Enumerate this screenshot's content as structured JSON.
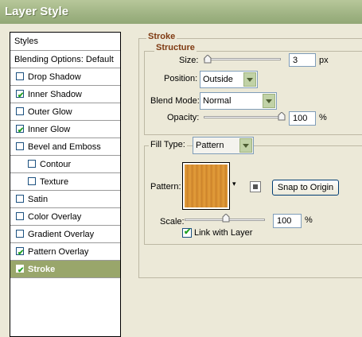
{
  "window": {
    "title": "Layer Style"
  },
  "sidebar": {
    "header": "Styles",
    "blending": "Blending Options: Default",
    "items": [
      {
        "label": "Drop Shadow",
        "checked": false
      },
      {
        "label": "Inner Shadow",
        "checked": true
      },
      {
        "label": "Outer Glow",
        "checked": false
      },
      {
        "label": "Inner Glow",
        "checked": true
      },
      {
        "label": "Bevel and Emboss",
        "checked": false
      },
      {
        "label": "Contour",
        "checked": false
      },
      {
        "label": "Texture",
        "checked": false
      },
      {
        "label": "Satin",
        "checked": false
      },
      {
        "label": "Color Overlay",
        "checked": false
      },
      {
        "label": "Gradient Overlay",
        "checked": false
      },
      {
        "label": "Pattern Overlay",
        "checked": true
      },
      {
        "label": "Stroke",
        "checked": true
      }
    ]
  },
  "stroke": {
    "title": "Stroke",
    "structure": {
      "title": "Structure",
      "size_label": "Size:",
      "size_value": "3",
      "size_unit": "px",
      "position_label": "Position:",
      "position_value": "Outside",
      "blend_label": "Blend Mode:",
      "blend_value": "Normal",
      "opacity_label": "Opacity:",
      "opacity_value": "100",
      "opacity_unit": "%"
    },
    "fill": {
      "type_label": "Fill Type:",
      "type_value": "Pattern",
      "pattern_label": "Pattern:",
      "snap_button": "Snap to Origin",
      "scale_label": "Scale:",
      "scale_value": "100",
      "scale_unit": "%",
      "link_label": "Link with Layer",
      "link_checked": true
    }
  },
  "colors": {
    "title_bar": "#9fb383",
    "selected_item": "#99a66b",
    "legend_text": "#7f3a12"
  }
}
